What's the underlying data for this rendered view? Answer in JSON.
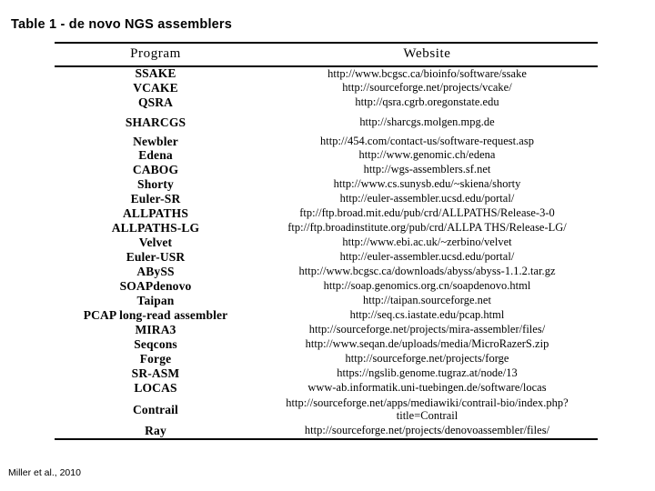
{
  "slide": {
    "title": "Table 1 - de novo NGS assemblers",
    "credit": "Miller et al., 2010"
  },
  "table": {
    "headers": {
      "program": "Program",
      "website": "Website"
    },
    "rows": [
      {
        "program": "SSAKE",
        "website": "http://www.bcgsc.ca/bioinfo/software/ssake"
      },
      {
        "program": "VCAKE",
        "website": "http://sourceforge.net/projects/vcake/"
      },
      {
        "program": "QSRA",
        "website": "http://qsra.cgrb.oregonstate.edu"
      },
      {
        "program": "SHARCGS",
        "website": "http://sharcgs.molgen.mpg.de"
      },
      {
        "program": "Newbler",
        "website": "http://454.com/contact-us/software-request.asp"
      },
      {
        "program": "Edena",
        "website": "http://www.genomic.ch/edena"
      },
      {
        "program": "CABOG",
        "website": "http://wgs-assemblers.sf.net"
      },
      {
        "program": "Shorty",
        "website": "http://www.cs.sunysb.edu/~skiena/shorty"
      },
      {
        "program": "Euler-SR",
        "website": "http://euler-assembler.ucsd.edu/portal/"
      },
      {
        "program": "ALLPATHS",
        "website": "ftp://ftp.broad.mit.edu/pub/crd/ALLPATHS/Release-3-0"
      },
      {
        "program": "ALLPATHS-LG",
        "website": "ftp://ftp.broadinstitute.org/pub/crd/ALLPA THS/Release-LG/"
      },
      {
        "program": "Velvet",
        "website": "http://www.ebi.ac.uk/~zerbino/velvet"
      },
      {
        "program": "Euler-USR",
        "website": "http://euler-assembler.ucsd.edu/portal/"
      },
      {
        "program": "ABySS",
        "website": "http://www.bcgsc.ca/downloads/abyss/abyss-1.1.2.tar.gz"
      },
      {
        "program": "SOAPdenovo",
        "website": "http://soap.genomics.org.cn/soapdenovo.html"
      },
      {
        "program": "Taipan",
        "website": "http://taipan.sourceforge.net"
      },
      {
        "program": "PCAP long-read assembler",
        "website": "http://seq.cs.iastate.edu/pcap.html"
      },
      {
        "program": "MIRA3",
        "website": "http://sourceforge.net/projects/mira-assembler/files/"
      },
      {
        "program": "Seqcons",
        "website": "http://www.seqan.de/uploads/media/MicroRazerS.zip"
      },
      {
        "program": "Forge",
        "website": "http://sourceforge.net/projects/forge"
      },
      {
        "program": "SR-ASM",
        "website": "https://ngslib.genome.tugraz.at/node/13"
      },
      {
        "program": "LOCAS",
        "website": "www-ab.informatik.uni-tuebingen.de/software/locas"
      },
      {
        "program": "Contrail",
        "website": "http://sourceforge.net/apps/mediawiki/contrail-bio/index.php?title=Contrail"
      },
      {
        "program": "Ray",
        "website": "http://sourceforge.net/projects/denovoassembler/files/"
      }
    ]
  }
}
